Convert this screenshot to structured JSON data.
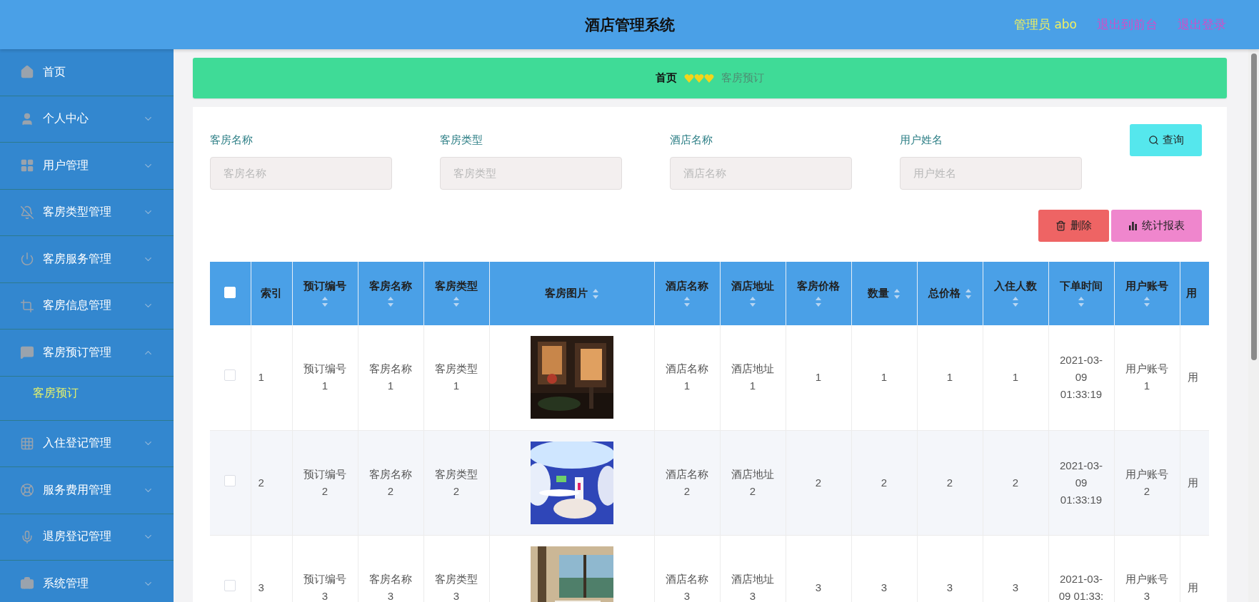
{
  "header": {
    "title": "酒店管理系统",
    "user": "管理员 abo",
    "links": [
      "退出到前台",
      "退出登录"
    ]
  },
  "sidebar": {
    "items": [
      {
        "kind": "link",
        "label": "首页"
      },
      {
        "kind": "group",
        "label": "个人中心",
        "expanded": false
      },
      {
        "kind": "group",
        "label": "用户管理",
        "expanded": false
      },
      {
        "kind": "group",
        "label": "客房类型管理",
        "expanded": false
      },
      {
        "kind": "group",
        "label": "客房服务管理",
        "expanded": false
      },
      {
        "kind": "group",
        "label": "客房信息管理",
        "expanded": false
      },
      {
        "kind": "group",
        "label": "客房预订管理",
        "expanded": true,
        "children": [
          {
            "label": "客房预订",
            "selected": true
          }
        ]
      },
      {
        "kind": "group",
        "label": "入住登记管理",
        "expanded": false
      },
      {
        "kind": "group",
        "label": "服务费用管理",
        "expanded": false
      },
      {
        "kind": "group",
        "label": "退房登记管理",
        "expanded": false
      },
      {
        "kind": "group",
        "label": "系统管理",
        "expanded": false
      }
    ]
  },
  "breadcrumb": [
    "首页",
    "客房预订"
  ],
  "search": {
    "fields": [
      {
        "label": "客房名称",
        "placeholder": "客房名称"
      },
      {
        "label": "客房类型",
        "placeholder": "客房类型"
      },
      {
        "label": "酒店名称",
        "placeholder": "酒店名称"
      },
      {
        "label": "用户姓名",
        "placeholder": "用户姓名"
      }
    ],
    "button": "查询"
  },
  "actions": [
    {
      "kind": "delete",
      "label": "删除"
    },
    {
      "kind": "report",
      "label": "统计报表"
    }
  ],
  "table": {
    "all_checked": false,
    "columns": [
      {
        "label": "索引",
        "sortable": false
      },
      {
        "label": "预订编号",
        "sortable": true
      },
      {
        "label": "客房名称",
        "sortable": true
      },
      {
        "label": "客房类型",
        "sortable": true
      },
      {
        "label": "客房图片",
        "sortable": true
      },
      {
        "label": "酒店名称",
        "sortable": true
      },
      {
        "label": "酒店地址",
        "sortable": true
      },
      {
        "label": "客房价格",
        "sortable": true
      },
      {
        "label": "数量",
        "sortable": true
      },
      {
        "label": "总价格",
        "sortable": true
      },
      {
        "label": "入住人数",
        "sortable": true
      },
      {
        "label": "下单时间",
        "sortable": true
      },
      {
        "label": "用户账号",
        "sortable": true
      },
      {
        "label": "用",
        "sortable": false
      }
    ],
    "rows": [
      {
        "checked": false,
        "cells": [
          "1",
          "预订编号1",
          "客房名称1",
          "客房类型1",
          {
            "kind": "picture"
          },
          "酒店名称1",
          "酒店地址1",
          "1",
          "1",
          "1",
          "1",
          "2021-03-09 01:33:19",
          "用户账号1",
          "用"
        ]
      },
      {
        "checked": false,
        "cells": [
          "2",
          "预订编号2",
          "客房名称2",
          "客房类型2",
          {
            "kind": "picture"
          },
          "酒店名称2",
          "酒店地址2",
          "2",
          "2",
          "2",
          "2",
          "2021-03-09 01:33:19",
          "用户账号2",
          "用"
        ]
      },
      {
        "checked": false,
        "cells": [
          "3",
          "预订编号3",
          "客房名称3",
          "客房类型3",
          {
            "kind": "picture"
          },
          "酒店名称3",
          "酒店地址3",
          "3",
          "3",
          "3",
          "3",
          "2021-03-09 01:33:",
          "用户账号3",
          "用"
        ]
      }
    ]
  }
}
